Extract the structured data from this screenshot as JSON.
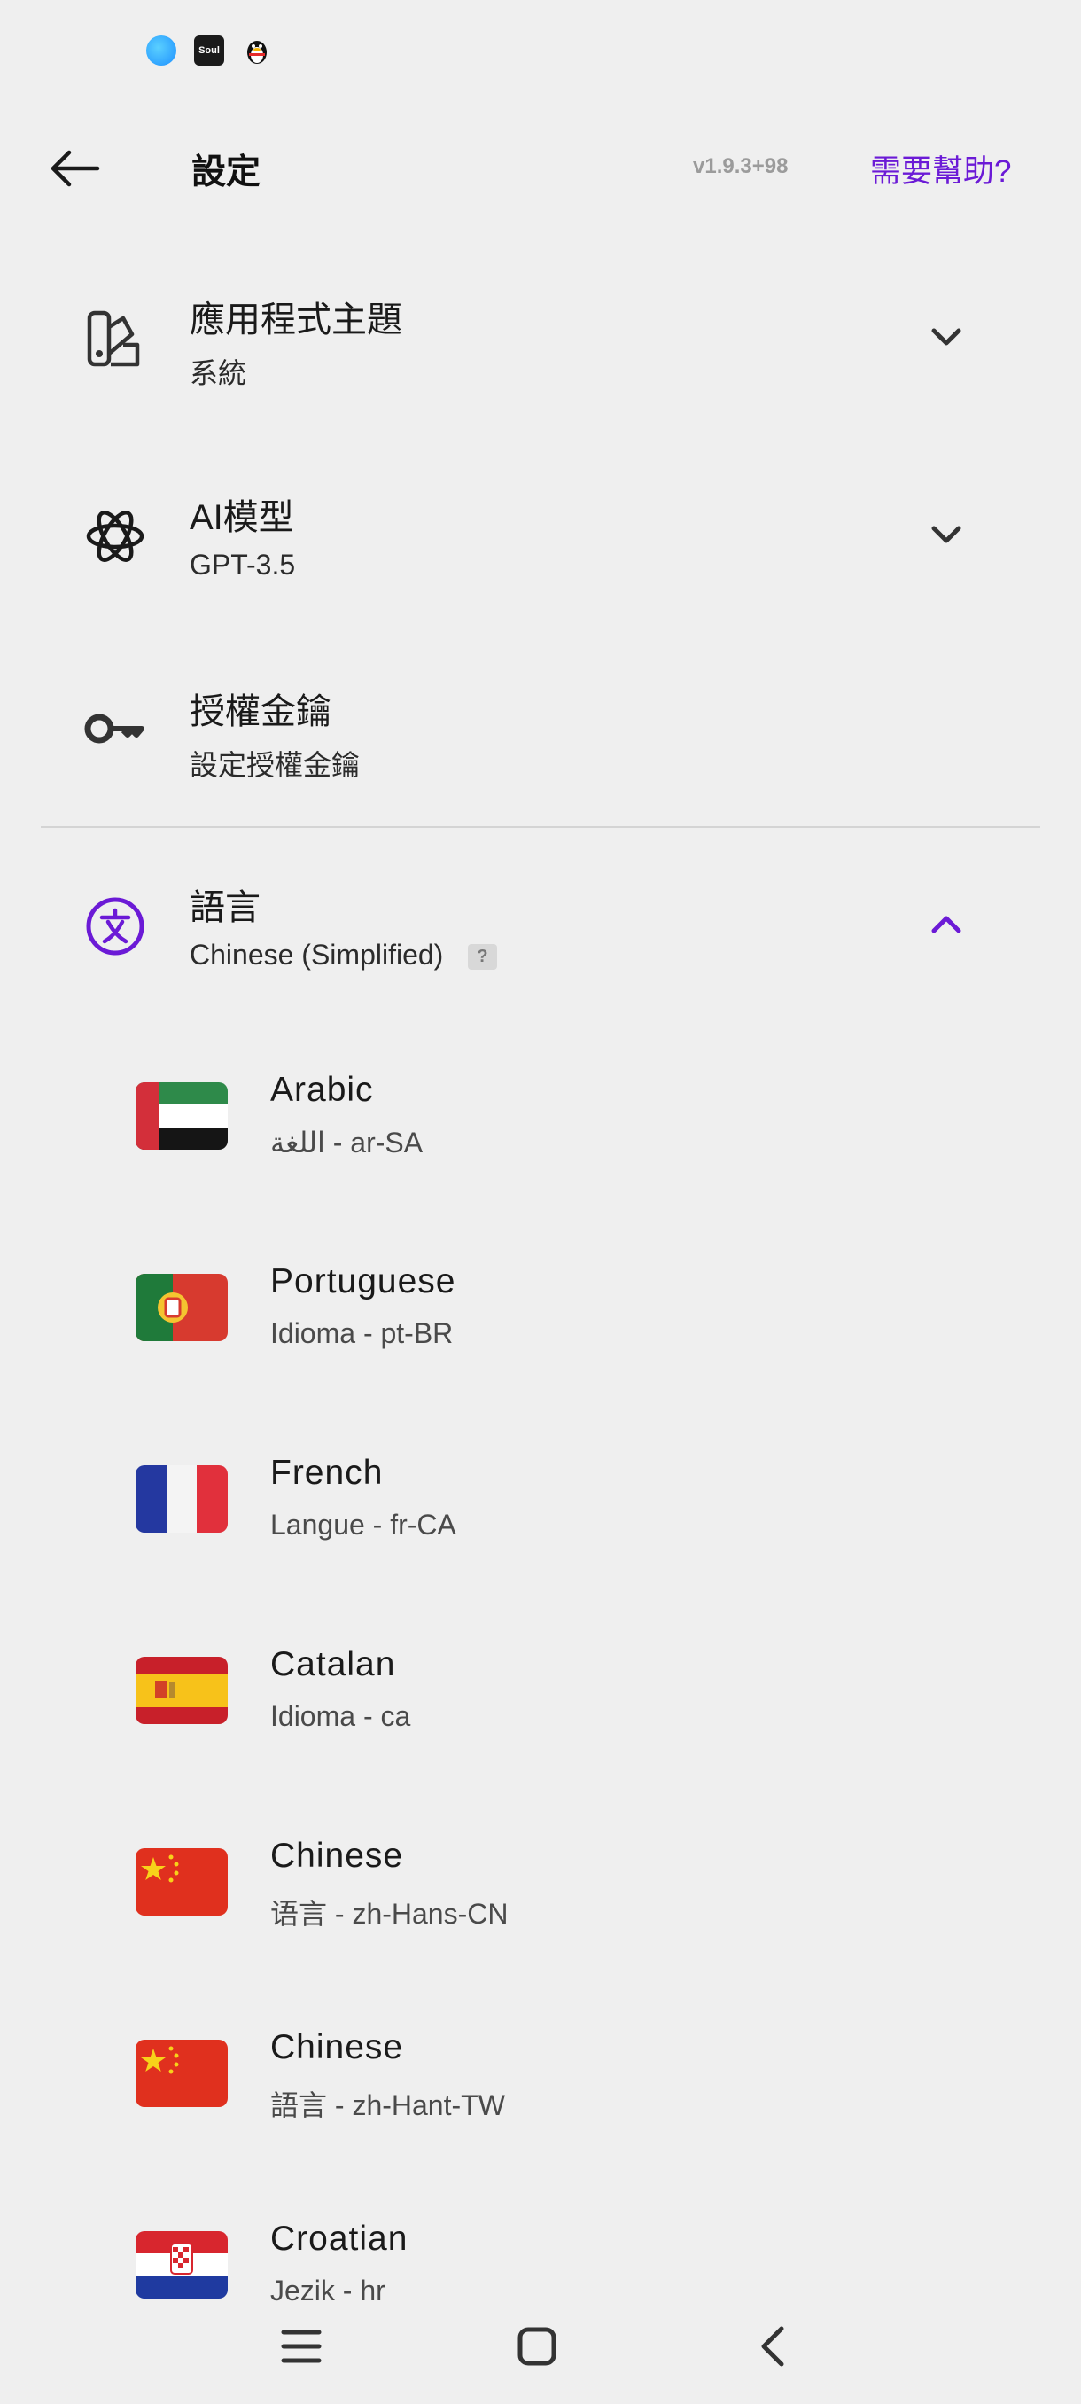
{
  "status_bar": {
    "icons": [
      "app-icon-blue",
      "soul-app-icon",
      "qq-penguin-icon"
    ],
    "soul_label": "Soul"
  },
  "header": {
    "title": "設定",
    "version": "v1.9.3+98",
    "help": "需要幫助?"
  },
  "settings": {
    "theme": {
      "title": "應用程式主題",
      "value": "系統"
    },
    "ai_model": {
      "title": "AI模型",
      "value": "GPT-3.5"
    },
    "api_key": {
      "title": "授權金鑰",
      "value": "設定授權金鑰"
    },
    "language": {
      "title": "語言",
      "value": "Chinese (Simplified)",
      "badge": "?"
    }
  },
  "languages": [
    {
      "name": "Arabic",
      "code": "اللغة - ar-SA",
      "flag": "uae"
    },
    {
      "name": "Portuguese",
      "code": "Idioma - pt-BR",
      "flag": "portugal"
    },
    {
      "name": "French",
      "code": "Langue - fr-CA",
      "flag": "france"
    },
    {
      "name": "Catalan",
      "code": "Idioma - ca",
      "flag": "spain"
    },
    {
      "name": "Chinese",
      "code": "语言 - zh-Hans-CN",
      "flag": "china"
    },
    {
      "name": "Chinese",
      "code": "語言 - zh-Hant-TW",
      "flag": "china"
    },
    {
      "name": "Croatian",
      "code": "Jezik - hr",
      "flag": "croatia"
    }
  ],
  "colors": {
    "accent": "#6b1ad6",
    "background": "#efefef"
  }
}
